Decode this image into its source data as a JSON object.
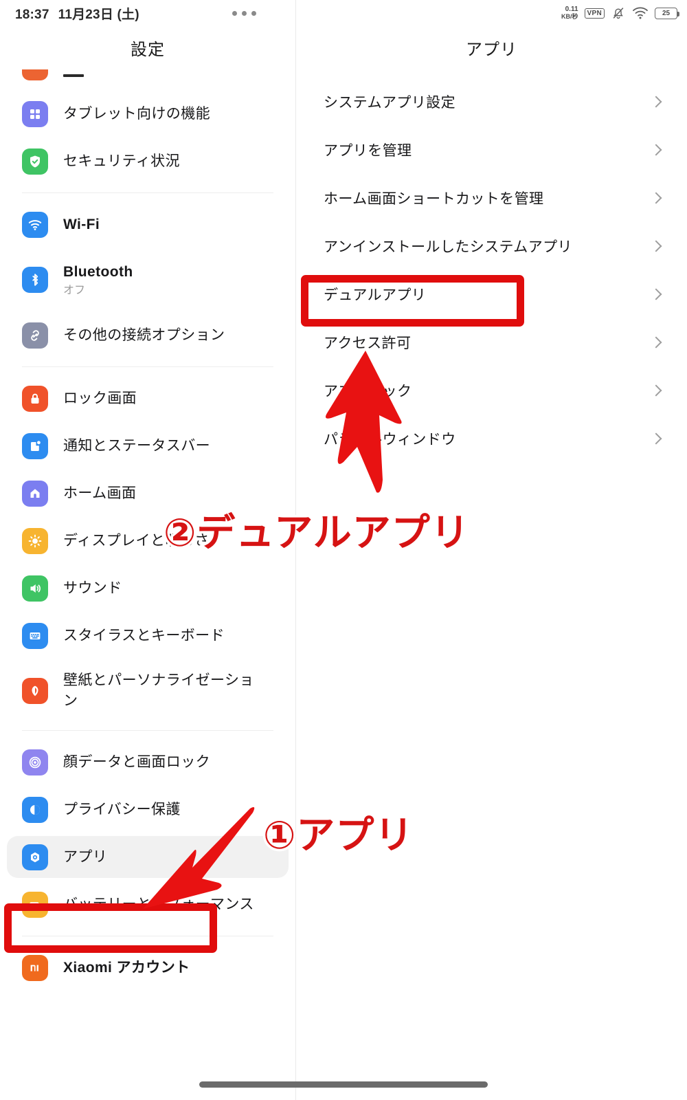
{
  "status_bar": {
    "time": "18:37",
    "date": "11月23日 (土)",
    "overflow_menu": "more-options",
    "net_speed_value": "0.11",
    "net_speed_unit": "KB/秒",
    "vpn": "VPN",
    "battery_percent": "25"
  },
  "sidebar": {
    "title": "設定",
    "groups": [
      {
        "items": [
          {
            "label": "タブレット向けの機能",
            "icon": "grid-icon",
            "color": "#7b7ef0"
          },
          {
            "label": "セキュリティ状況",
            "icon": "shield-check-icon",
            "color": "#3fc464"
          }
        ]
      },
      {
        "items": [
          {
            "label": "Wi-Fi",
            "icon": "wifi-icon",
            "color": "#2d8cf0",
            "bold": true
          },
          {
            "label": "Bluetooth",
            "sub": "オフ",
            "icon": "bluetooth-icon",
            "color": "#2d8cf0",
            "bold": true
          },
          {
            "label": "その他の接続オプション",
            "icon": "link-icon",
            "color": "#8a90a8"
          }
        ]
      },
      {
        "items": [
          {
            "label": "ロック画面",
            "icon": "lock-icon",
            "color": "#f0522a"
          },
          {
            "label": "通知とステータスバー",
            "icon": "notification-icon",
            "color": "#2d8cf0"
          },
          {
            "label": "ホーム画面",
            "icon": "home-icon",
            "color": "#7b7ef0"
          },
          {
            "label": "ディスプレイと明るさ",
            "icon": "brightness-icon",
            "color": "#f7b430"
          },
          {
            "label": "サウンド",
            "icon": "speaker-icon",
            "color": "#3fc464"
          },
          {
            "label": "スタイラスとキーボード",
            "icon": "keyboard-icon",
            "color": "#2d8cf0"
          },
          {
            "label": "壁紙とパーソナライゼーション",
            "icon": "wallpaper-icon",
            "color": "#f0522a"
          }
        ]
      },
      {
        "items": [
          {
            "label": "顔データと画面ロック",
            "icon": "fingerprint-icon",
            "color": "#8f85ef"
          },
          {
            "label": "プライバシー保護",
            "icon": "privacy-icon",
            "color": "#2d8cf0"
          },
          {
            "label": "アプリ",
            "icon": "apps-icon",
            "color": "#2d8cf0",
            "selected": true
          },
          {
            "label": "バッテリーとパフォーマンス",
            "icon": "battery-icon",
            "color": "#f7b430"
          }
        ]
      },
      {
        "items": [
          {
            "label": "Xiaomi アカウント",
            "icon": "mi-logo-icon",
            "color": "#f06a1e",
            "bold": true
          }
        ]
      }
    ]
  },
  "detail": {
    "title": "アプリ",
    "items": [
      {
        "label": "システムアプリ設定",
        "chevron": "chevron-right-icon"
      },
      {
        "label": "アプリを管理",
        "chevron": "chevron-right-icon"
      },
      {
        "label": "ホーム画面ショートカットを管理",
        "chevron": "chevron-right-icon"
      },
      {
        "label": "アンインストールしたシステムアプリ",
        "chevron": "chevron-right-icon"
      },
      {
        "label": "デュアルアプリ",
        "chevron": "chevron-right-icon",
        "highlighted": true
      },
      {
        "label": "アクセス許可",
        "chevron": "chevron-right-icon"
      },
      {
        "label": "アプリロック",
        "chevron": "chevron-right-icon"
      },
      {
        "label": "パラレルウィンドウ",
        "chevron": "chevron-right-icon"
      }
    ]
  },
  "annotations": {
    "color": "#d61313",
    "box_color": "#e00d0d",
    "step1_text": "①アプリ",
    "step2_text": "②デュアルアプリ",
    "step1_arrow": "arrow-down-left-icon",
    "step2_arrow": "arrow-up-icon"
  }
}
